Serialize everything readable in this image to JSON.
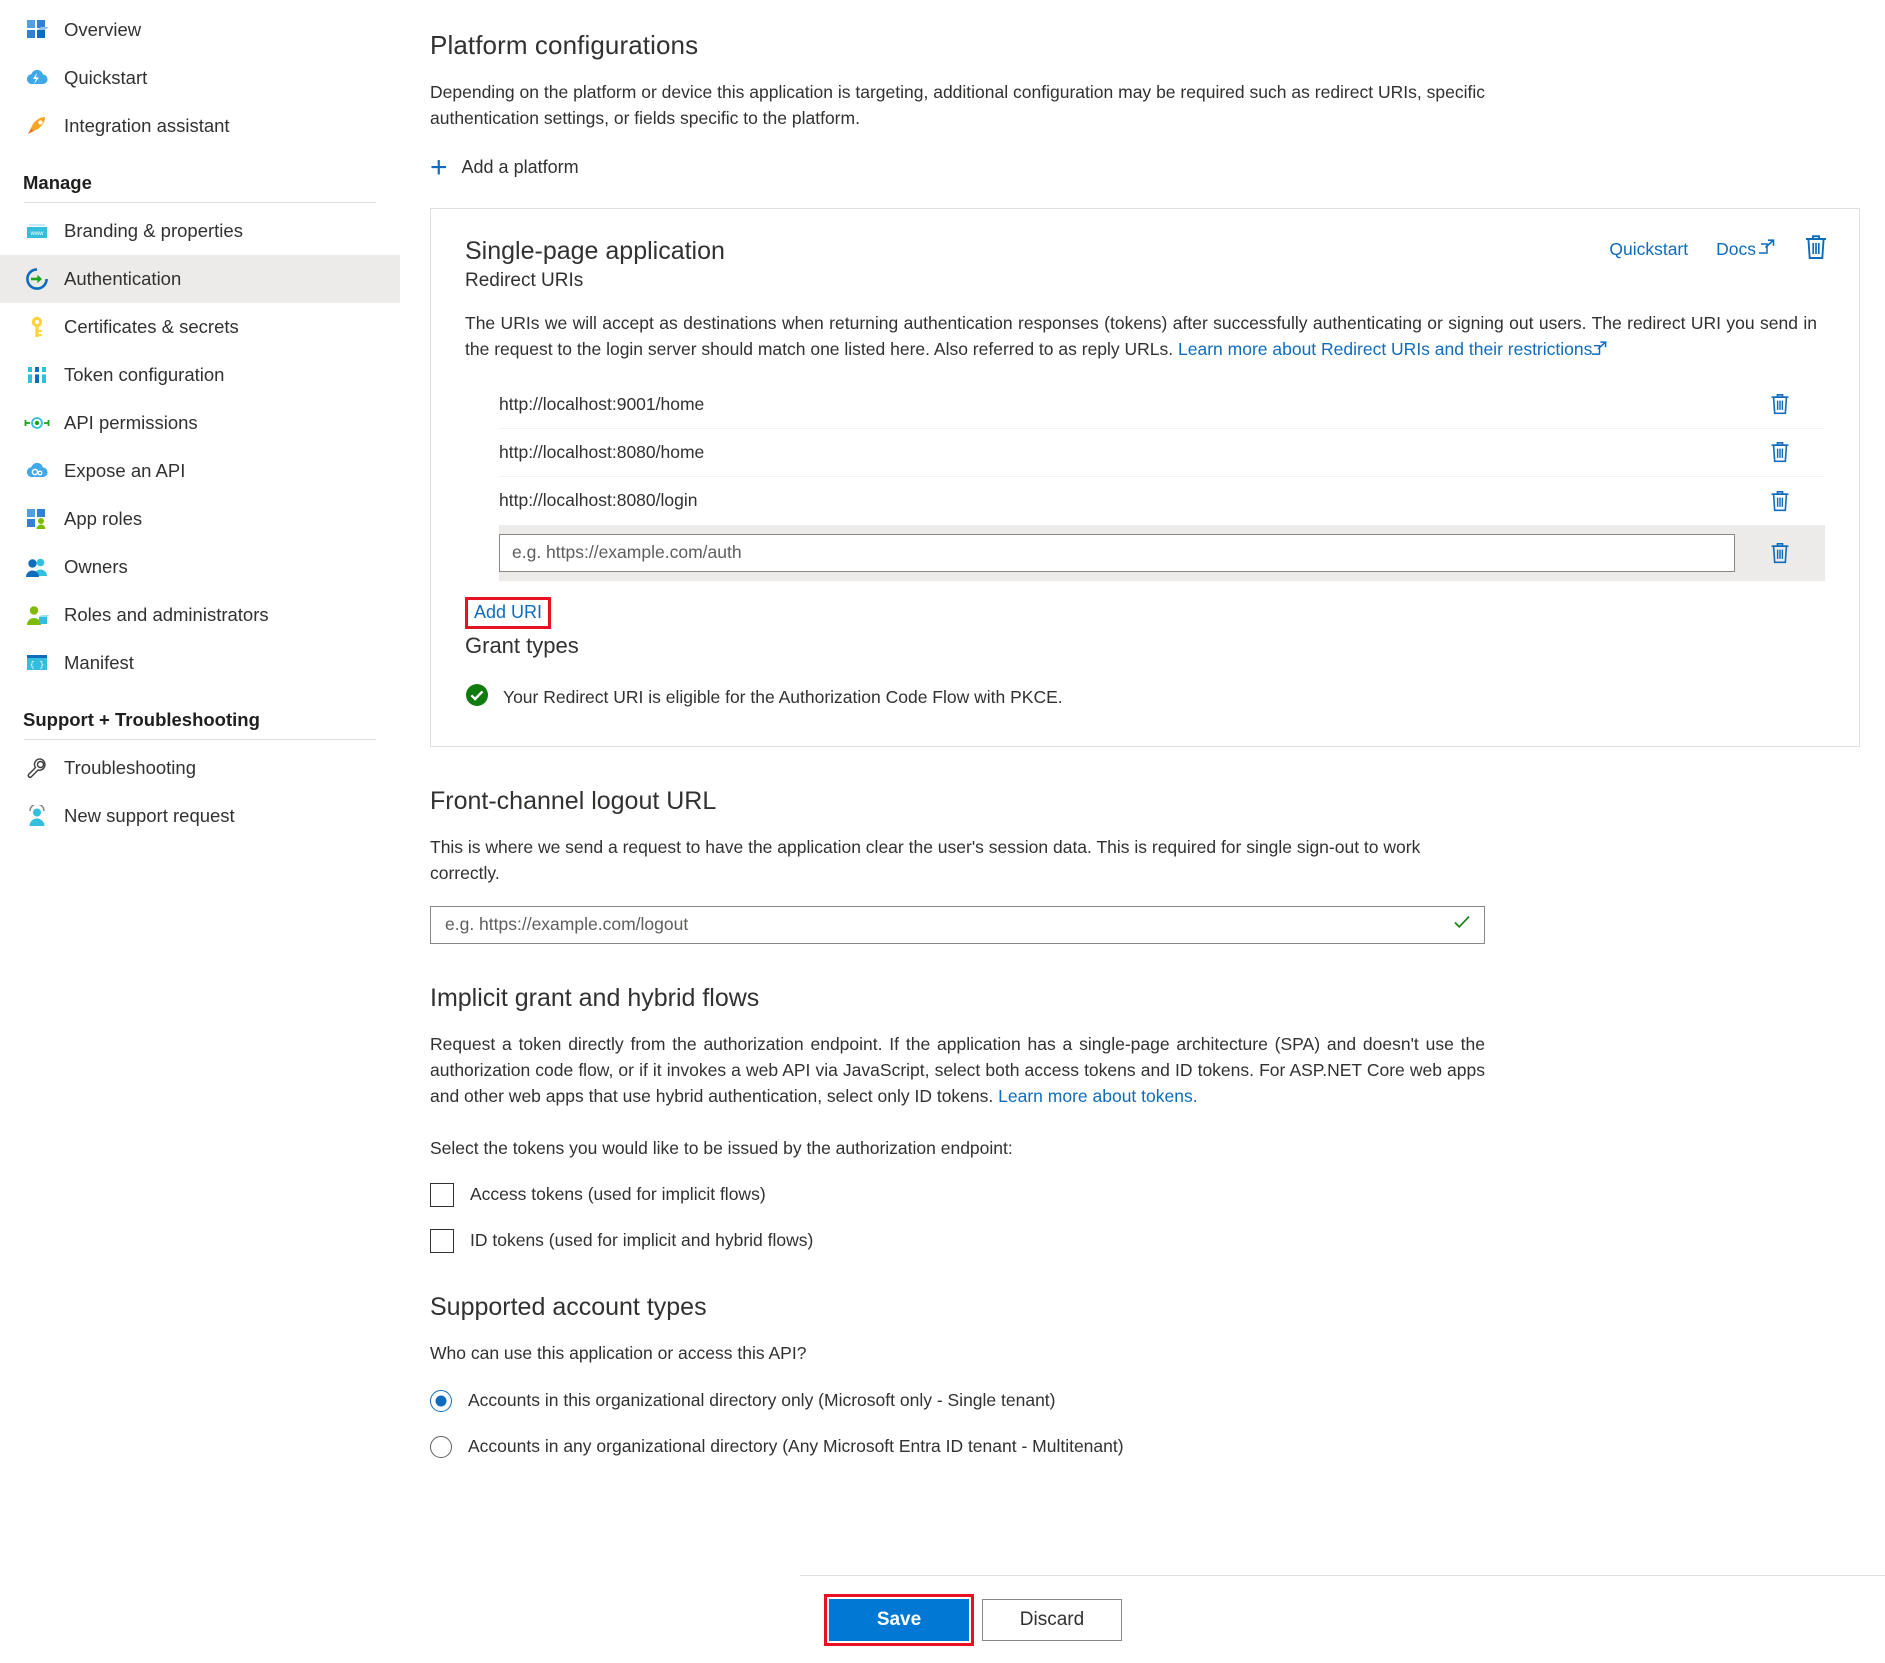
{
  "sidebar": {
    "top_items": [
      {
        "label": "Overview",
        "icon": "grid-overview-icon"
      },
      {
        "label": "Quickstart",
        "icon": "cloud-lightning-icon"
      },
      {
        "label": "Integration assistant",
        "icon": "rocket-icon"
      }
    ],
    "groups": [
      {
        "title": "Manage",
        "items": [
          {
            "label": "Branding & properties",
            "icon": "browser-www-icon",
            "selected": false
          },
          {
            "label": "Authentication",
            "icon": "arrow-in-circle-icon",
            "selected": true
          },
          {
            "label": "Certificates & secrets",
            "icon": "key-icon",
            "selected": false
          },
          {
            "label": "Token configuration",
            "icon": "bars-token-icon",
            "selected": false
          },
          {
            "label": "API permissions",
            "icon": "api-node-icon",
            "selected": false
          },
          {
            "label": "Expose an API",
            "icon": "cloud-gear-icon",
            "selected": false
          },
          {
            "label": "App roles",
            "icon": "grid-person-icon",
            "selected": false
          },
          {
            "label": "Owners",
            "icon": "people-icon",
            "selected": false
          },
          {
            "label": "Roles and administrators",
            "icon": "person-badge-icon",
            "selected": false
          },
          {
            "label": "Manifest",
            "icon": "braces-icon",
            "selected": false
          }
        ]
      },
      {
        "title": "Support + Troubleshooting",
        "items": [
          {
            "label": "Troubleshooting",
            "icon": "wrench-icon",
            "selected": false
          },
          {
            "label": "New support request",
            "icon": "support-person-icon",
            "selected": false
          }
        ]
      }
    ]
  },
  "main": {
    "platform_configurations": {
      "title": "Platform configurations",
      "description": "Depending on the platform or device this application is targeting, additional configuration may be required such as redirect URIs, specific authentication settings, or fields specific to the platform.",
      "add_platform_label": "Add a platform"
    },
    "platform_card": {
      "title": "Single-page application",
      "subtitle": "Redirect URIs",
      "quickstart_label": "Quickstart",
      "docs_label": "Docs",
      "description_before_link": "The URIs we will accept as destinations when returning authentication responses (tokens) after successfully authenticating or signing out users. The redirect URI you send in the request to the login server should match one listed here. Also referred to as reply URLs. ",
      "description_link": "Learn more about Redirect URIs and their restrictions",
      "redirect_uris": [
        "http://localhost:9001/home",
        "http://localhost:8080/home",
        "http://localhost:8080/login"
      ],
      "new_uri_placeholder": "e.g. https://example.com/auth",
      "new_uri_value": "",
      "add_uri_label": "Add URI",
      "grant_types_title": "Grant types",
      "grant_types_status": "Your Redirect URI is eligible for the Authorization Code Flow with PKCE."
    },
    "front_channel_logout": {
      "title": "Front-channel logout URL",
      "description": "This is where we send a request to have the application clear the user's session data. This is required for single sign-out to work correctly.",
      "placeholder": "e.g. https://example.com/logout",
      "value": ""
    },
    "implicit_grant": {
      "title": "Implicit grant and hybrid flows",
      "description_before_link": "Request a token directly from the authorization endpoint. If the application has a single-page architecture (SPA) and doesn't use the authorization code flow, or if it invokes a web API via JavaScript, select both access tokens and ID tokens. For ASP.NET Core web apps and other web apps that use hybrid authentication, select only ID tokens. ",
      "description_link": "Learn more about tokens.",
      "select_prompt": "Select the tokens you would like to be issued by the authorization endpoint:",
      "checkboxes": [
        {
          "label": "Access tokens (used for implicit flows)",
          "checked": false
        },
        {
          "label": "ID tokens (used for implicit and hybrid flows)",
          "checked": false
        }
      ]
    },
    "supported_account_types": {
      "title": "Supported account types",
      "question": "Who can use this application or access this API?",
      "options": [
        {
          "label": "Accounts in this organizational directory only (Microsoft only - Single tenant)",
          "selected": true
        },
        {
          "label": "Accounts in any organizational directory (Any Microsoft Entra ID tenant - Multitenant)",
          "selected": false
        }
      ]
    }
  },
  "command_bar": {
    "save_label": "Save",
    "discard_label": "Discard"
  },
  "colors": {
    "accent_blue": "#0f6cbd",
    "primary_button": "#0078d4",
    "highlight_red": "#e81123",
    "success_green": "#107c10",
    "selected_row": "#edebe9"
  }
}
